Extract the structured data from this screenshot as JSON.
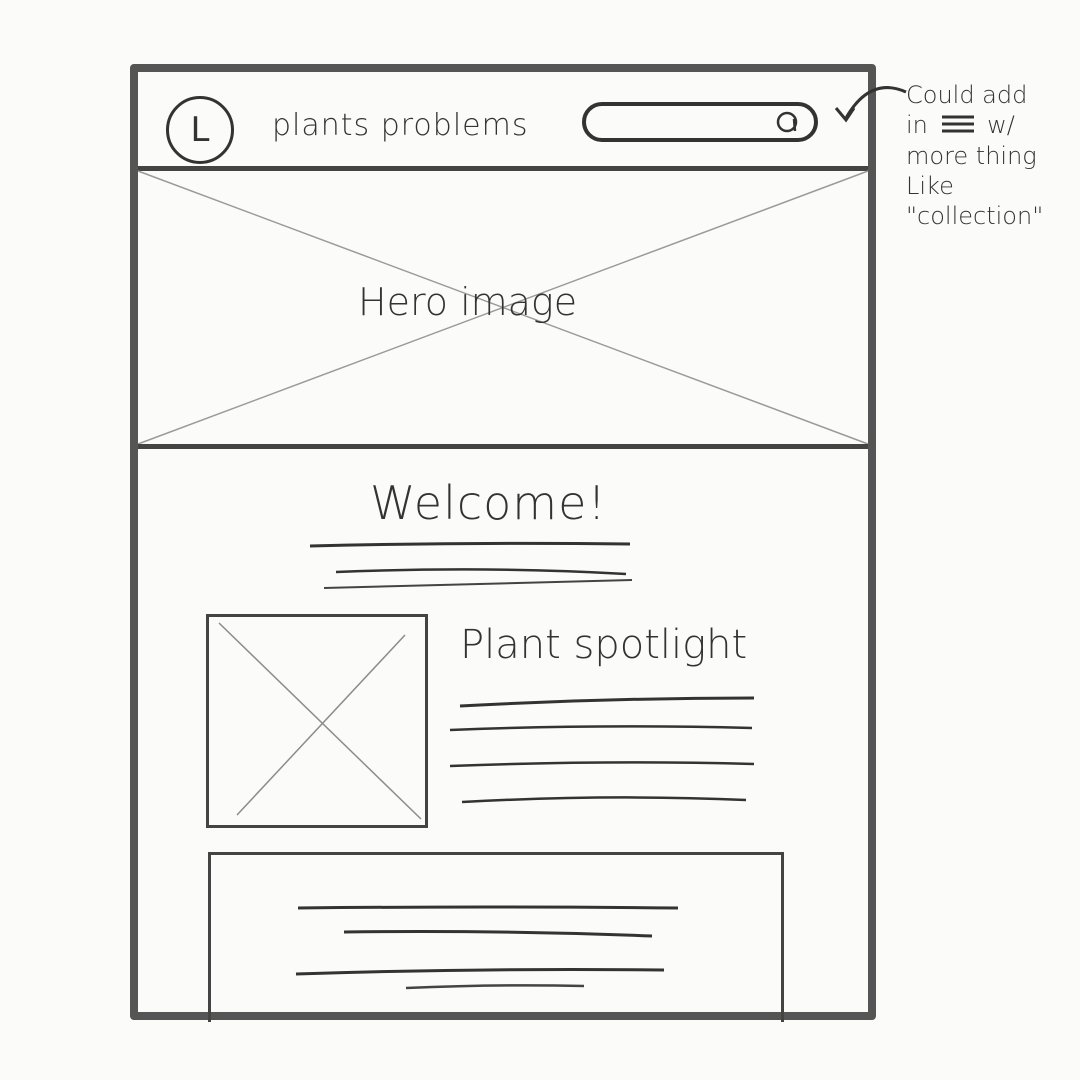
{
  "header": {
    "logo_letter": "L",
    "nav_title": "plants problems",
    "search_icon": "search-icon"
  },
  "hero": {
    "label": "Hero image"
  },
  "welcome": {
    "title": "Welcome!"
  },
  "spotlight": {
    "title": "Plant spotlight"
  },
  "annotation": {
    "line1": "Could add",
    "line2": "in",
    "line2_suffix": "w/",
    "line3": "more thing",
    "line4": "Like",
    "line5": "\"collection\""
  },
  "colors": {
    "ink": "#333333",
    "frame": "#555555",
    "paper": "#fbfbfa"
  }
}
